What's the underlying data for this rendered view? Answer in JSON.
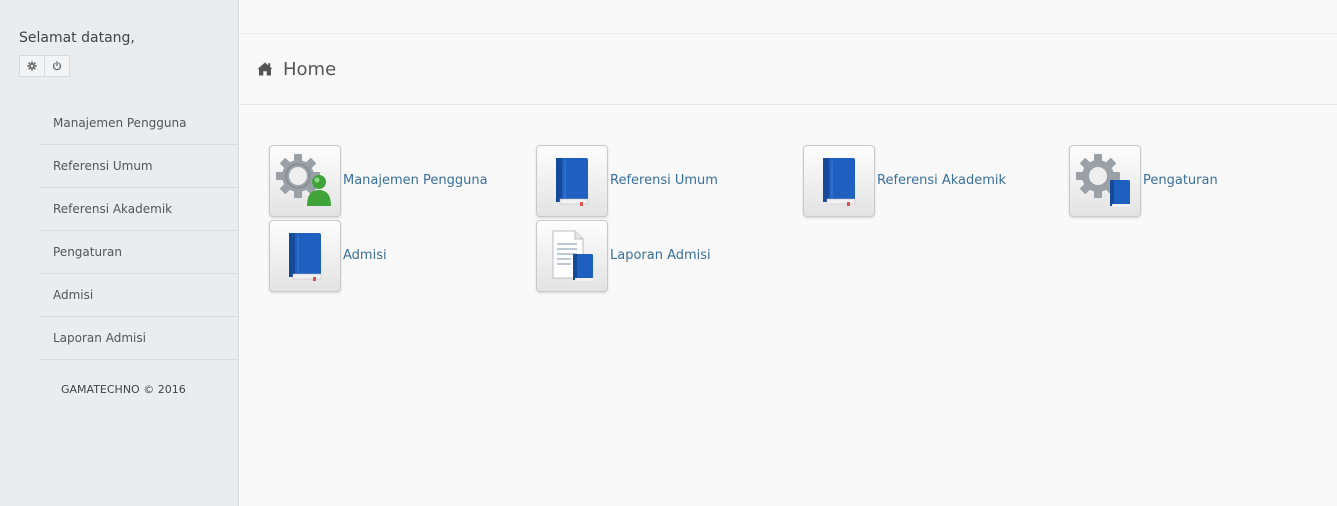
{
  "sidebar": {
    "welcome": "Selamat datang,",
    "buttons": [
      {
        "icon": "gear-icon"
      },
      {
        "icon": "power-icon"
      }
    ],
    "items": [
      {
        "label": "Manajemen Pengguna"
      },
      {
        "label": "Referensi Umum"
      },
      {
        "label": "Referensi Akademik"
      },
      {
        "label": "Pengaturan"
      },
      {
        "label": "Admisi"
      },
      {
        "label": "Laporan Admisi"
      }
    ],
    "footer": "GAMATECHNO © 2016"
  },
  "header": {
    "icon": "home-icon",
    "title": "Home"
  },
  "tiles": [
    {
      "label": "Manajemen Pengguna",
      "icon": "gear-user-icon"
    },
    {
      "label": "Referensi Umum",
      "icon": "book-icon"
    },
    {
      "label": "Referensi Akademik",
      "icon": "book-icon"
    },
    {
      "label": "Pengaturan",
      "icon": "gear-book-icon"
    },
    {
      "label": "Admisi",
      "icon": "book-icon"
    },
    {
      "label": "Laporan Admisi",
      "icon": "document-book-icon"
    }
  ],
  "colors": {
    "sidebar_bg": "#e9edef",
    "link": "#3a6f9a",
    "book_blue": "#1f5fbf",
    "user_green": "#3fa33a"
  }
}
